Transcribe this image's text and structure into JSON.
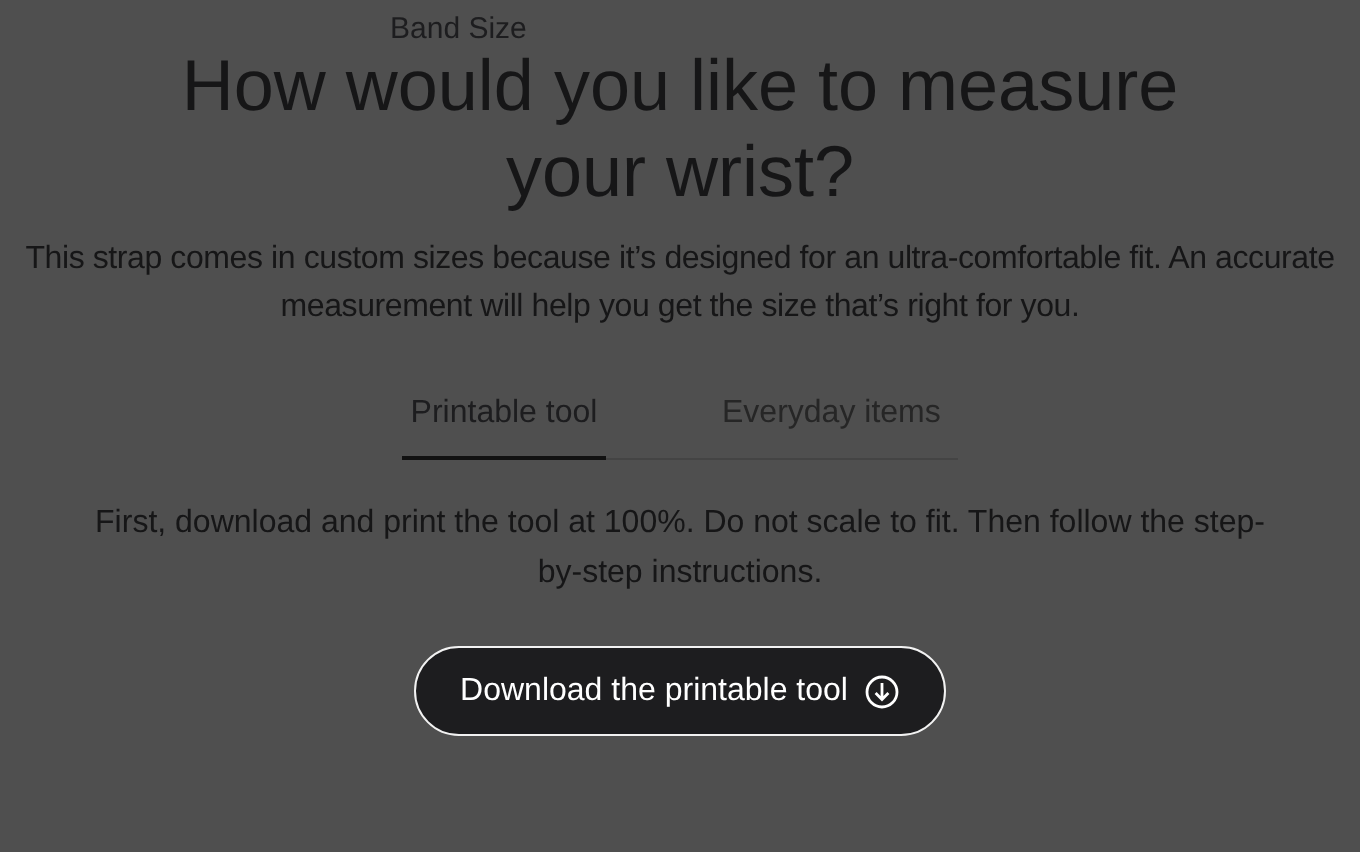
{
  "section_label": "Band Size",
  "heading": "How would you like to measure your wrist?",
  "description": "This strap comes in custom sizes because it’s designed for an ultra-comfortable fit. An accurate measurement will help you get the size that’s right for you.",
  "tabs": [
    {
      "label": "Printable tool",
      "selected": true
    },
    {
      "label": "Everyday items",
      "selected": false
    }
  ],
  "instructions": "First, download and print the tool at 100%. Do not scale to fit. Then follow the step-by-step instructions.",
  "download_button": {
    "label": "Download the printable tool"
  }
}
